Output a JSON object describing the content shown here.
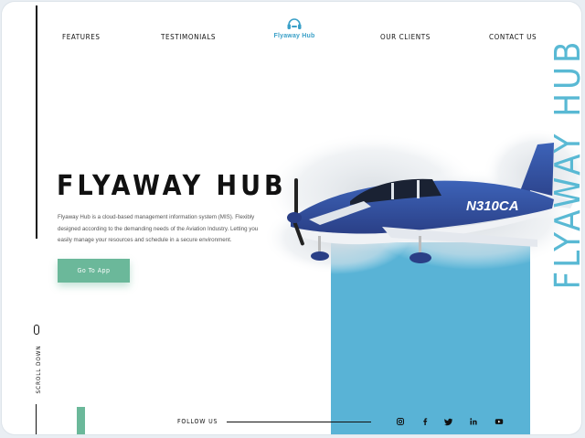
{
  "nav": {
    "features": "FEATURES",
    "testimonials": "TESTIMONIALS",
    "clients": "OUR CLIENTS",
    "contact": "CONTACT US"
  },
  "logo": {
    "text": "Flyaway Hub",
    "icon": "headset-icon"
  },
  "vertical_brand": "FLYAWAY HUB",
  "hero": {
    "title": "FLYAWAY HUB",
    "description": "Flyaway Hub is a cloud-based management information system (MIS). Flexibly designed according to the demanding needs of the Aviation Industry. Letting you easily manage your resources and schedule in a secure environment.",
    "cta_label": "Go To App"
  },
  "scroll": {
    "label": "SCROLL DOWN"
  },
  "footer": {
    "follow_label": "FOLLOW US",
    "social": [
      "instagram-icon",
      "facebook-icon",
      "twitter-icon",
      "linkedin-icon",
      "youtube-icon"
    ]
  },
  "plane": {
    "registration": "N310CA"
  },
  "colors": {
    "accent_blue": "#59b3d6",
    "accent_green": "#6bb89a",
    "text_dark": "#111111"
  }
}
